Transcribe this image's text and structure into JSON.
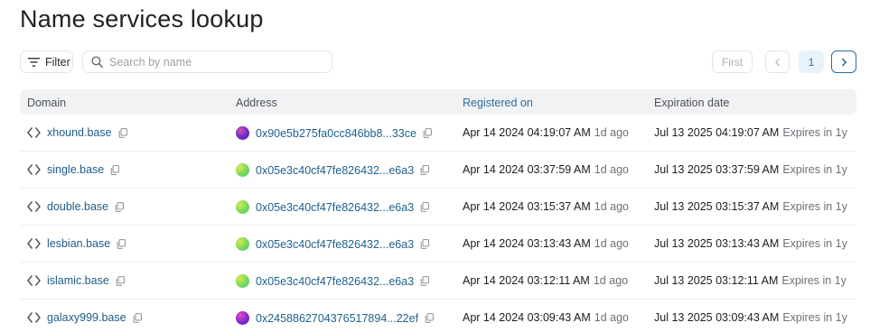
{
  "page_title": "Name services lookup",
  "toolbar": {
    "filter_label": "Filter",
    "search_placeholder": "Search by name"
  },
  "pagination": {
    "first_label": "First",
    "current_page": "1"
  },
  "table": {
    "columns": {
      "domain": "Domain",
      "address": "Address",
      "registered": "Registered on",
      "expiration": "Expiration date"
    },
    "rows": [
      {
        "domain": "xhound.base",
        "address": "0x90e5b275fa0cc846bb8...33ce",
        "avatar_color": "#6d2ac7",
        "registered": "Apr 14 2024 04:19:07 AM",
        "registered_ago": "1d ago",
        "expiration": "Jul 13 2025 04:19:07 AM",
        "expires_in": "Expires in 1y"
      },
      {
        "domain": "single.base",
        "address": "0x05e3c40cf47fe826432...e6a3",
        "avatar_color": "#7fd95a",
        "registered": "Apr 14 2024 03:37:59 AM",
        "registered_ago": "1d ago",
        "expiration": "Jul 13 2025 03:37:59 AM",
        "expires_in": "Expires in 1y"
      },
      {
        "domain": "double.base",
        "address": "0x05e3c40cf47fe826432...e6a3",
        "avatar_color": "#7fd95a",
        "registered": "Apr 14 2024 03:15:37 AM",
        "registered_ago": "1d ago",
        "expiration": "Jul 13 2025 03:15:37 AM",
        "expires_in": "Expires in 1y"
      },
      {
        "domain": "lesbian.base",
        "address": "0x05e3c40cf47fe826432...e6a3",
        "avatar_color": "#7fd95a",
        "registered": "Apr 14 2024 03:13:43 AM",
        "registered_ago": "1d ago",
        "expiration": "Jul 13 2025 03:13:43 AM",
        "expires_in": "Expires in 1y"
      },
      {
        "domain": "islamic.base",
        "address": "0x05e3c40cf47fe826432...e6a3",
        "avatar_color": "#7fd95a",
        "registered": "Apr 14 2024 03:12:11 AM",
        "registered_ago": "1d ago",
        "expiration": "Jul 13 2025 03:12:11 AM",
        "expires_in": "Expires in 1y"
      },
      {
        "domain": "galaxy999.base",
        "address": "0x2458862704376517894...22ef",
        "avatar_color": "#7b2bd3",
        "registered": "Apr 14 2024 03:09:43 AM",
        "registered_ago": "1d ago",
        "expiration": "Jul 13 2025 03:09:43 AM",
        "expires_in": "Expires in 1y"
      }
    ]
  },
  "colors": {
    "link": "#1f5f8b",
    "accent": "#2c6d9b",
    "header_bg": "#f1f2f4",
    "current_page_bg": "#e6f3fb"
  },
  "icons": {
    "filter": "filter-icon",
    "search": "search-icon",
    "domain": "code-brackets-icon",
    "copy": "copy-icon",
    "prev": "chevron-left-icon",
    "next": "chevron-right-icon"
  }
}
